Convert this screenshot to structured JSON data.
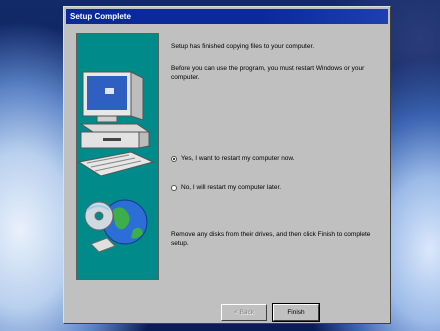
{
  "window": {
    "title": "Setup Complete"
  },
  "content": {
    "line1": "Setup has finished copying files to your computer.",
    "line2": "Before you can use the program, you must restart Windows or your computer.",
    "option_yes": "Yes, I want to restart my computer now.",
    "option_no": "No, I will restart my computer later.",
    "instruction": "Remove any disks from their drives, and then click Finish to complete setup."
  },
  "buttons": {
    "back": "< Back",
    "finish": "Finish"
  },
  "selected_option": "yes",
  "colors": {
    "title_bar": "#0a2a9c",
    "side_panel": "#008a8a",
    "dialog_bg": "#c0c0c0"
  }
}
